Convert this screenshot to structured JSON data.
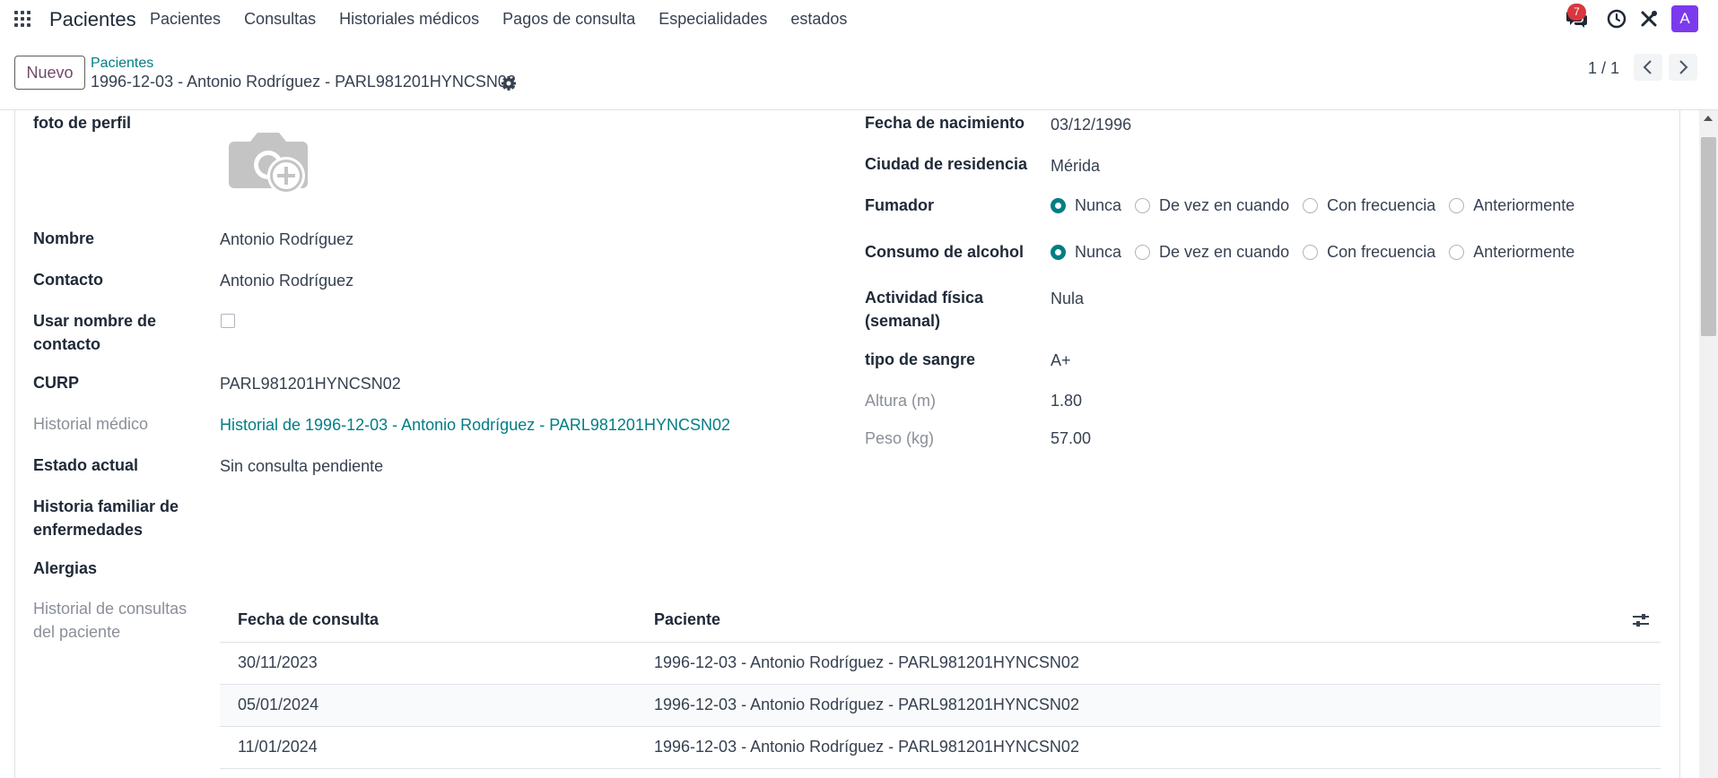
{
  "navbar": {
    "brand": "Pacientes",
    "menu": [
      "Pacientes",
      "Consultas",
      "Historiales médicos",
      "Pagos de consulta",
      "Especialidades",
      "estados"
    ],
    "messages_count": "7",
    "avatar_letter": "A",
    "icons": [
      "apps-icon",
      "chat-icon",
      "clock-icon",
      "tools-icon"
    ]
  },
  "control": {
    "new_button": "Nuevo",
    "breadcrumb_parent": "Pacientes",
    "breadcrumb_current": "1996-12-03 - Antonio Rodríguez - PARL981201HYNCSN02",
    "pager": "1 / 1"
  },
  "form": {
    "left": {
      "photo_label": "foto de perfil",
      "nombre_label": "Nombre",
      "nombre_value": "Antonio Rodríguez",
      "contacto_label": "Contacto",
      "contacto_value": "Antonio Rodríguez",
      "usar_nombre_label": "Usar nombre de contacto",
      "usar_nombre_checked": false,
      "curp_label": "CURP",
      "curp_value": "PARL981201HYNCSN02",
      "historial_label": "Historial médico",
      "historial_value": "Historial de 1996-12-03 - Antonio Rodríguez - PARL981201HYNCSN02",
      "estado_label": "Estado actual",
      "estado_value": "Sin consulta pendiente",
      "historia_familiar_label": "Historia familiar de enfermedades",
      "alergias_label": "Alergias",
      "historial_consultas_label": "Historial de consultas del paciente"
    },
    "right": {
      "nacimiento_label": "Fecha de nacimiento",
      "nacimiento_value": "03/12/1996",
      "ciudad_label": "Ciudad de residencia",
      "ciudad_value": "Mérida",
      "fumador_label": "Fumador",
      "fumador_options": [
        "Nunca",
        "De vez en cuando",
        "Con frecuencia",
        "Anteriormente"
      ],
      "fumador_selected": "Nunca",
      "alcohol_label": "Consumo de alcohol",
      "alcohol_options": [
        "Nunca",
        "De vez en cuando",
        "Con frecuencia",
        "Anteriormente"
      ],
      "alcohol_selected": "Nunca",
      "actividad_label": "Actividad física (semanal)",
      "actividad_value": "Nula",
      "sangre_label": "tipo de sangre",
      "sangre_value": "A+",
      "altura_label": "Altura (m)",
      "altura_value": "1.80",
      "peso_label": "Peso (kg)",
      "peso_value": "57.00"
    }
  },
  "consultas_table": {
    "columns": [
      "Fecha de consulta",
      "Paciente"
    ],
    "rows": [
      [
        "30/11/2023",
        "1996-12-03 - Antonio Rodríguez - PARL981201HYNCSN02"
      ],
      [
        "05/01/2024",
        "1996-12-03 - Antonio Rodríguez - PARL981201HYNCSN02"
      ],
      [
        "11/01/2024",
        "1996-12-03 - Antonio Rodríguez - PARL981201HYNCSN02"
      ]
    ]
  },
  "colors": {
    "accent": "#017e84",
    "brand": "#714b67",
    "badge": "#d9363e",
    "avatar": "#7c3aed"
  }
}
